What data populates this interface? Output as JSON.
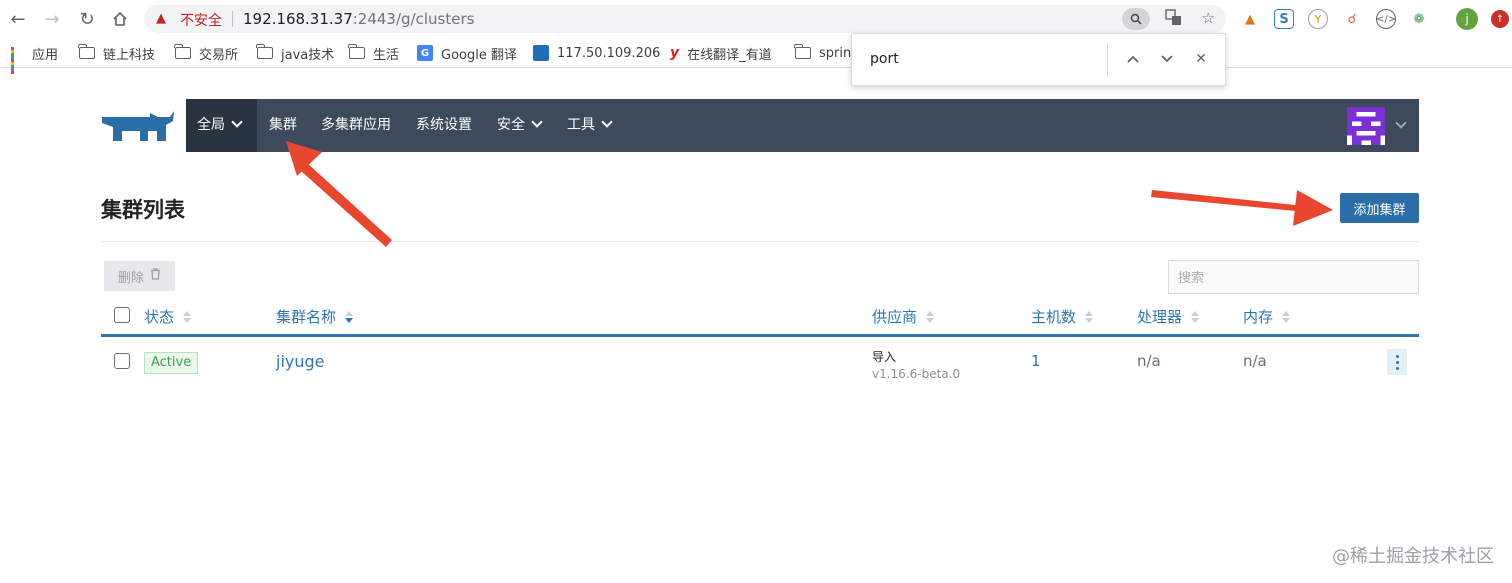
{
  "browser": {
    "omnibox": {
      "warning_label": "不安全",
      "url_host": "192.168.31.37",
      "url_rest": ":2443/g/clusters"
    },
    "profile_initial": "j",
    "bookmarks": [
      {
        "label": "应用",
        "icon": "apps-grid-icon"
      },
      {
        "label": "链上科技",
        "icon": "folder-icon"
      },
      {
        "label": "交易所",
        "icon": "folder-icon"
      },
      {
        "label": "java技术",
        "icon": "folder-icon"
      },
      {
        "label": "生活",
        "icon": "folder-icon"
      },
      {
        "label": "Google 翻译",
        "icon": "google-translate-icon"
      },
      {
        "label": "117.50.109.206",
        "icon": "server-icon"
      },
      {
        "label": "在线翻译_有道",
        "icon": "youdao-icon"
      },
      {
        "label": "spring",
        "icon": "folder-icon"
      }
    ],
    "find_bar": {
      "query": "port"
    }
  },
  "app": {
    "nav": {
      "global_label": "全局",
      "items": [
        "集群",
        "多集群应用",
        "系统设置",
        "安全",
        "工具"
      ]
    },
    "page_title": "集群列表",
    "add_cluster_label": "添加集群",
    "delete_label": "删除",
    "search_placeholder": "搜索",
    "table": {
      "headers": [
        "状态",
        "集群名称",
        "供应商",
        "主机数",
        "处理器",
        "内存"
      ],
      "rows": [
        {
          "status": "Active",
          "name": "jiyuge",
          "provider": "导入",
          "version": "v1.16.6-beta.0",
          "nodes": "1",
          "cpu": "n/a",
          "memory": "n/a"
        }
      ]
    }
  },
  "watermark": "@稀土掘金技术社区",
  "colors": {
    "accent": "#2e75b6",
    "navbar": "#3d4a5c",
    "button": "#2b6da6",
    "status_active": "#3ea44a",
    "annotation_arrow": "#e8462f"
  }
}
